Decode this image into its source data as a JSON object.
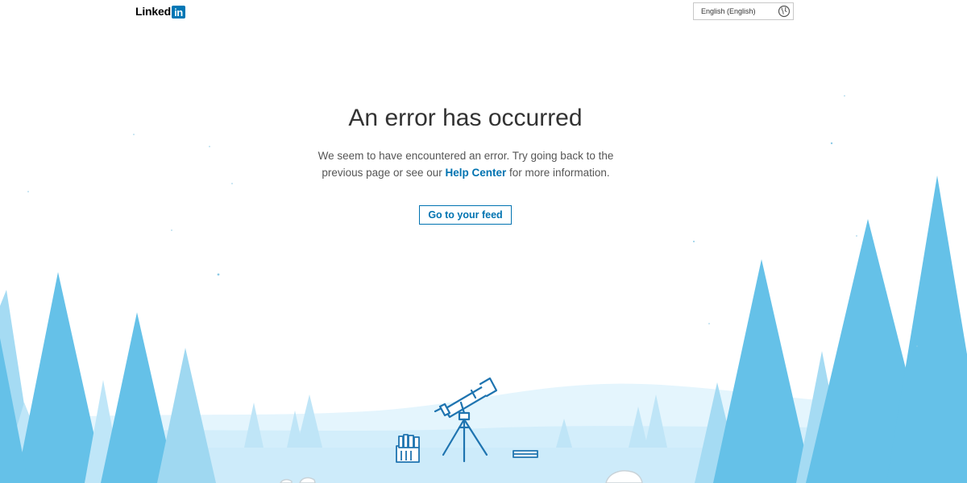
{
  "header": {
    "logo_text": "Linked",
    "logo_box_text": "in",
    "language_label": "English (English)"
  },
  "error": {
    "title": "An error has occurred",
    "message_part1": "We seem to have encountered an error. Try going back to the previous page or see our",
    "help_link": "Help Center",
    "message_part2": "for more information.",
    "button_label": "Go to your feed"
  },
  "colors": {
    "brand_blue": "#0073b1",
    "logo_blue": "#0077b5",
    "tree_blue": "#69c3e8",
    "tree_light": "#9fd8f1",
    "ground": "#d3eefb",
    "telescope": "#1f74b0"
  },
  "icons": [
    "globe-icon",
    "telescope-icon",
    "books-icon",
    "book-icon"
  ]
}
